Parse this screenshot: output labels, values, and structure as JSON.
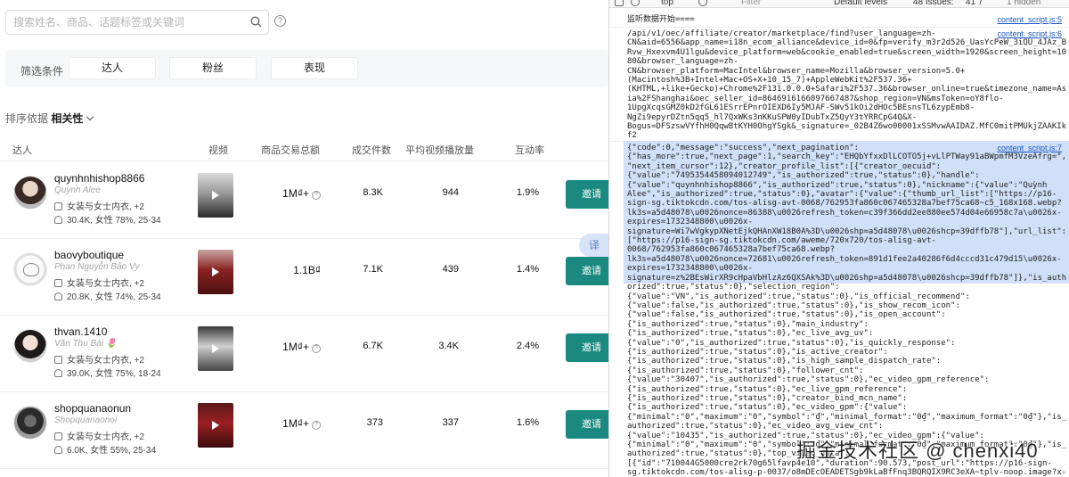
{
  "search": {
    "placeholder": "搜索姓名、商品、话题标签或关键词"
  },
  "filter": {
    "label": "筛选条件",
    "buttons": [
      "达人",
      "粉丝",
      "表现"
    ]
  },
  "sort": {
    "label": "排序依据",
    "value": "相关性"
  },
  "table": {
    "headers": [
      "达人",
      "视频",
      "商品交易总额",
      "成交件数",
      "平均视频播放量",
      "互动率"
    ],
    "invite_label": "邀请",
    "rows": [
      {
        "username": "quynhnhishop8866",
        "nickname": "Quỳnh Alee",
        "category": "女装与女士内衣, +2",
        "followers": "30.4K, 女性 78%, 25-34",
        "gmv": "1M₫+",
        "units": "8.3K",
        "avg_views": "944",
        "engagement": "1.9%"
      },
      {
        "username": "baovyboutique",
        "nickname": "Phan Nguyễn Bảo Vy",
        "category": "女装与女士内衣, +2",
        "followers": "20.8K, 女性 74%, 25-34",
        "gmv": "1.1B₫",
        "units": "7.1K",
        "avg_views": "439",
        "engagement": "1.4%"
      },
      {
        "username": "thvan.1410",
        "nickname": "Văn Thu Bài 🌷",
        "category": "女装与女士内衣, +2",
        "followers": "39.0K, 女性 75%, 18-24",
        "gmv": "1M₫+",
        "units": "6.7K",
        "avg_views": "3.4K",
        "engagement": "2.4%"
      },
      {
        "username": "shopquanaonun",
        "nickname": "Shopquanaonoi",
        "category": "女装与女士内衣, +2",
        "followers": "6.0K, 女性 55%, 25-34",
        "gmv": "1M₫+",
        "units": "373",
        "avg_views": "337",
        "engagement": "1.6%"
      }
    ]
  },
  "translate_label": "译",
  "devtools": {
    "toolbar": {
      "context": "top",
      "filter_placeholder": "Filter",
      "levels": "Default levels",
      "issues": "48 Issues:",
      "issue_counts": "41  7",
      "hidden": "1 hidden"
    },
    "logs": [
      {
        "text": "监听数据开始====",
        "source": "content_script.js:5"
      },
      {
        "text": "/api/v1/oec/affiliate/creator/marketplace/find?user_language=zh-\nCN&aid=6556&app_name=i18n_ecom_alliance&device_id=0&fp=verify_m3r2d526_UasYcPeW_3iQU_4JAz_B\nRvw_Hxexvm4U1lgu&device_platform=web&cookie_enabled=true&screen_width=1920&screen_height=10\n80&browser_language=zh-\nCN&browser_platform=MacIntel&browser_name=Mozilla&browser_version=5.0+\n(Macintosh%3B+Intel+Mac+OS+X+10_15_7)+AppleWebKit%2F537.36+\n(KHTML,+like+Gecko)+Chrome%2F131.0.0.0+Safari%2F537.36&browser_online=true&timezone_name=As\nia%2FShanghai&oec_seller_id=8646916166097667487&shop_region=VN&msToken=oY8flo-\n1UpgXcqsGMZ0kD2fGL61ESrrEPnrOIEXD6Iy5MJAF-SWv51kOi2dHOc5BEsnsTL6zypEmb8-\nNgZi9epyrDZtn5qq5_hl7QxWKs3nKKuSPW0yIDubTxZ5QyY3tYRRCpG4Q&X-\nBogus=DFSzswVYfhH0QqwBtKYH0OhgYSgk&_signature=_02B4Z6wo00001xSSMvwAAIDAZ.MfC0mitPMUkjZAAKIk\nf2",
        "source": "content_script.js:6"
      },
      {
        "text": "{\"code\":0,\"message\":\"success\",\"next_pagination\":\n{\"has_more\":true,\"next_page\":1,\"search_key\":\"EHQbYfxxDlLCOTO5j+vLlPTWay91aBWpmfM3VzeAfrg=\",\n\"next_item_cursor\":12},\"creator_profile_list\":[{\"creator_oecuid\":\n{\"value\":\"7495354458094012749\",\"is_authorized\":true,\"status\":0},\"handle\":\n{\"value\":\"quynhnhishop8866\",\"is_authorized\":true,\"status\":0},\"nickname\":{\"value\":\"Quỳnh\nAlee\",\"is_authorized\":true,\"status\":0},\"avatar\":{\"value\":{\"thumb_url_list\":[\"https://p16-\nsign-sg.tiktokcdn.com/tos-alisg-avt-0068/762953fa860c067465328a7bef75ca68~c5_168x168.webp?\nlk3s=a5d48078\\u0026nonce=86388\\u0026refresh_token=c39f366dd2ee880ee574d04e66958c7a\\u0026x-\nexpires=1732348800\\u0026x-\nsignature=Wi7wVgkypXNetEjkQHAnXW18B0A%3D\\u0026shp=a5d48078\\u0026shcp=39dffb78\"],\"url_list\":\n[\"https://p16-sign-sg.tiktokcdn.com/aweme/720x720/tos-alisg-avt-\n0068/762953fa860c067465328a7bef75ca68.webp?\nlk3s=a5d48078\\u0026nonce=72681\\u0026refresh_token=891d1fee2a40286f6d4cccd31c479d15\\u0026x-\nexpires=1732348800\\u0026x-\nsignature=z%2BEsWirXR9cHpaVbHlzAz6QXSAk%3D\\u0026shp=a5d48078\\u0026shcp=39dffb78\"]},\"is_auth\norized\":true,\"status\":0},\"selection_region\":\n{\"value\":\"VN\",\"is_authorized\":true,\"status\":0},\"is_official_recommend\":\n{\"value\":false,\"is_authorized\":true,\"status\":0},\"is_show_recom_icon\":\n{\"value\":false,\"is_authorized\":true,\"status\":0},\"is_open_account\":\n{\"is_authorized\":true,\"status\":0},\"main_industry\":\n{\"is_authorized\":true,\"status\":0},\"ec_live_avg_uv\":\n{\"value\":\"0\",\"is_authorized\":true,\"status\":0},\"is_quickly_response\":\n{\"is_authorized\":true,\"status\":0},\"is_active_creator\":\n{\"is_authorized\":true,\"status\":0},\"is_high_sample_dispatch_rate\":\n{\"is_authorized\":true,\"status\":0},\"follower_cnt\":\n{\"value\":\"30407\",\"is_authorized\":true,\"status\":0},\"ec_video_gpm_reference\":\n{\"is_authorized\":true,\"status\":0},\"ec_live_gpm_reference\":\n{\"is_authorized\":true,\"status\":0},\"creator_bind_mcn_name\":\n{\"is_authorized\":true,\"status\":0},\"ec_video_gpm\":{\"value\":\n{\"minimal\":\"0\",\"maximum\":\"0\",\"symbol\":\"₫\",\"minimal_format\":\"0₫\",\"maximum_format\":\"0₫\"},\"is_\nauthorized\":true,\"status\":0},\"ec_video_avg_view_cnt\":\n{\"value\":\"10435\",\"is_authorized\":true,\"status\":0},\"ec_video_gpm\":{\"value\":\n{\"minimal\":\"0\",\"maximum\":\"0\",\"symbol\":\"₫\",\"minimal_format\":\"0₫\",\"maximum_format\":\"0₫\"},\"is_\nauthorized\":true,\"status\":0},\"top_video_data\":\n[{\"id\":\"710044G5000cre2rk70g65lfavp4e10\",\"duration\":90.573,\"post_url\":\"https://p16-sign-\nsg.tiktokcdn.com/tos-alisg-p-0037/o8mDEcOEADETSgb9kLaBfFnq3BQRQIX9RC3eXA~tplv-noop.image?x-",
        "source": "content_script.js:7"
      }
    ]
  },
  "watermark": "掘金技术社区 @ chenxi40"
}
